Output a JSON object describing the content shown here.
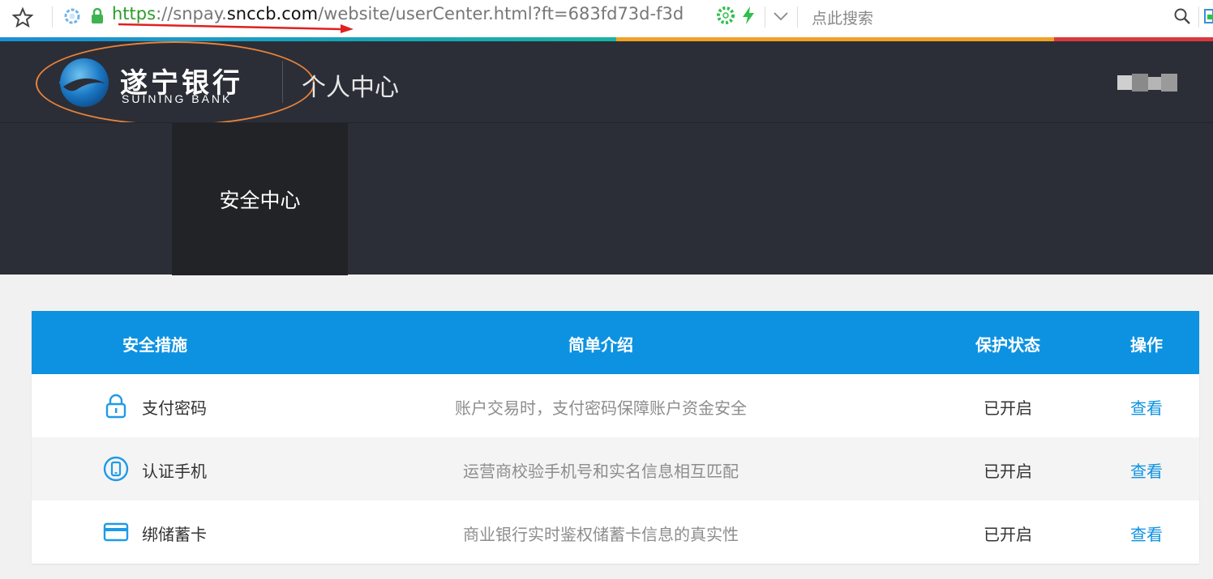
{
  "browser": {
    "url_scheme": "https",
    "url_rest_pre": "://snpay.",
    "url_host": "snccb.com",
    "url_path": "/website/userCenter.html?ft=683fd73d-f3d",
    "search_placeholder": "点此搜索"
  },
  "header": {
    "logo_zh": "遂宁银行",
    "logo_en": "SUINING BANK",
    "title": "个人中心"
  },
  "subnav": {
    "active_tab": "安全中心"
  },
  "table": {
    "headers": [
      "安全措施",
      "简单介绍",
      "保护状态",
      "操作"
    ],
    "rows": [
      {
        "icon": "lock-icon",
        "name": "支付密码",
        "desc": "账户交易时，支付密码保障账户资金安全",
        "status": "已开启",
        "action": "查看"
      },
      {
        "icon": "phone-icon",
        "name": "认证手机",
        "desc": "运营商校验手机号和实名信息相互匹配",
        "status": "已开启",
        "action": "查看"
      },
      {
        "icon": "card-icon",
        "name": "绑储蓄卡",
        "desc": "商业银行实时鉴权储蓄卡信息的真实性",
        "status": "已开启",
        "action": "查看"
      }
    ]
  },
  "colors": {
    "header_bg": "#2b2e37",
    "table_header_bg": "#0d92e1",
    "link": "#0d92e1",
    "annotation_oval": "#e8833a",
    "annotation_arrow": "#e02020"
  }
}
